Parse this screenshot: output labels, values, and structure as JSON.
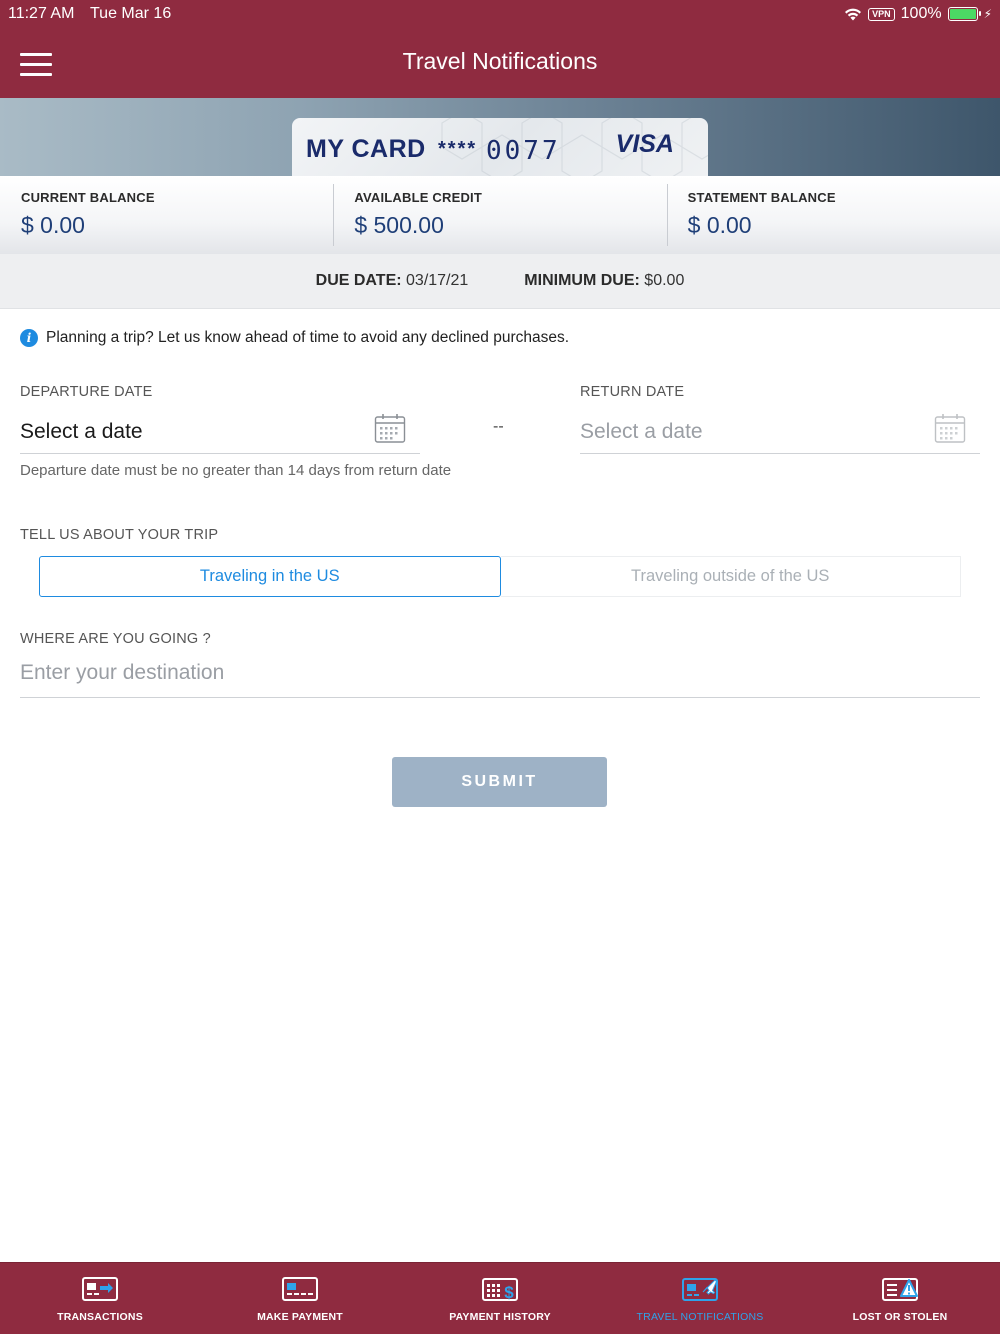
{
  "status_bar": {
    "time": "11:27 AM",
    "date": "Tue Mar 16",
    "vpn": "VPN",
    "battery": "100%"
  },
  "header": {
    "title": "Travel Notifications"
  },
  "card": {
    "name": "MY CARD",
    "mask": "****",
    "last4": "0077",
    "brand": "VISA"
  },
  "balances": [
    {
      "label": "CURRENT BALANCE",
      "value": "$ 0.00"
    },
    {
      "label": "AVAILABLE CREDIT",
      "value": "$ 500.00"
    },
    {
      "label": "STATEMENT BALANCE",
      "value": "$ 0.00"
    }
  ],
  "due": {
    "due_label": "DUE DATE:",
    "due_value": "03/17/21",
    "min_label": "MINIMUM DUE:",
    "min_value": "$0.00"
  },
  "info": {
    "text": "Planning a trip? Let us know ahead of time to avoid any declined purchases."
  },
  "departure": {
    "label": "DEPARTURE DATE",
    "value": "Select a date"
  },
  "return": {
    "label": "RETURN DATE",
    "value": "Select a date"
  },
  "separator": "--",
  "hint": "Departure date must be no greater than 14 days from return date",
  "trip": {
    "label": "TELL US ABOUT YOUR TRIP",
    "options": [
      "Traveling in the US",
      "Traveling outside of the US"
    ],
    "selected": "Traveling in the US"
  },
  "destination": {
    "label": "WHERE ARE YOU GOING ?",
    "placeholder": "Enter your destination"
  },
  "submit_label": "SUBMIT",
  "tabs": [
    {
      "label": "TRANSACTIONS",
      "icon": "transactions-icon",
      "active": false
    },
    {
      "label": "MAKE PAYMENT",
      "icon": "make-payment-icon",
      "active": false
    },
    {
      "label": "PAYMENT HISTORY",
      "icon": "payment-history-icon",
      "active": false
    },
    {
      "label": "TRAVEL NOTIFICATIONS",
      "icon": "travel-notifications-icon",
      "active": true
    },
    {
      "label": "LOST OR STOLEN",
      "icon": "lost-or-stolen-icon",
      "active": false
    }
  ],
  "colors": {
    "brand": "#8f2b40",
    "accent": "#1e8be0",
    "balance_text": "#1f3f78",
    "submit_disabled": "#9eb2c6"
  }
}
